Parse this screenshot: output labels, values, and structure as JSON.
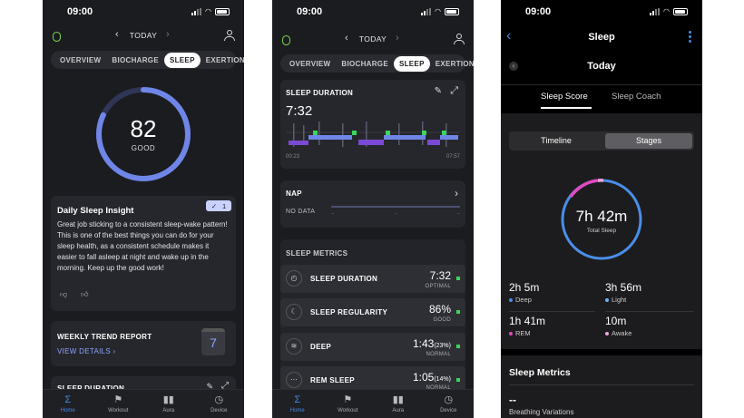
{
  "status": {
    "time": "09:00"
  },
  "nav": {
    "date": "TODAY"
  },
  "tabs": [
    "OVERVIEW",
    "BIOCHARGE",
    "SLEEP",
    "EXERTION"
  ],
  "bottom_tabs": [
    {
      "label": "Home",
      "icon": "sigma-icon"
    },
    {
      "label": "Workout",
      "icon": "runner-icon"
    },
    {
      "label": "Aura",
      "icon": "bars-icon"
    },
    {
      "label": "Device",
      "icon": "watch-icon"
    }
  ],
  "phone1": {
    "score": "82",
    "score_label": "GOOD",
    "score_fraction": 0.82,
    "insight": {
      "title": "Daily Sleep Insight",
      "badge": "1",
      "body": "Great job sticking to a consistent sleep-wake pattern! This is one of the best things you can do for your sleep health, as a consistent schedule makes it easier to fall asleep at night and wake up in the morning. Keep up the good work!"
    },
    "weekly": {
      "title": "WEEKLY TREND REPORT",
      "link": "VIEW DETAILS",
      "calendar_day": "7"
    },
    "next_section": "SLEEP DURATION"
  },
  "phone2": {
    "duration_card": {
      "title": "SLEEP DURATION",
      "value": "7:32",
      "start": "00:23",
      "end": "07:57"
    },
    "nap_card": {
      "title": "NAP",
      "value": "NO DATA",
      "ticks": [
        "--",
        "--",
        "--"
      ]
    },
    "metrics_title": "SLEEP METRICS",
    "metrics": [
      {
        "label": "SLEEP DURATION",
        "value": "7:32",
        "extra": "",
        "status": "OPTIMAL",
        "icon": "clock-icon"
      },
      {
        "label": "SLEEP REGULARITY",
        "value": "86%",
        "extra": "",
        "status": "GOOD",
        "icon": "moon-icon"
      },
      {
        "label": "DEEP",
        "value": "1:43",
        "extra": "(23%)",
        "status": "NORMAL",
        "icon": "deep-sleep-icon"
      },
      {
        "label": "REM SLEEP",
        "value": "1:05",
        "extra": "(14%)",
        "status": "NORMAL",
        "icon": "rem-icon"
      }
    ]
  },
  "phone3": {
    "title": "Sleep",
    "day": "Today",
    "segments": [
      "Sleep Score",
      "Sleep Coach"
    ],
    "toggles": [
      "Timeline",
      "Stages"
    ],
    "total": "7h 42m",
    "total_label": "Total Sleep",
    "stages": [
      {
        "value": "2h 5m",
        "label": "Deep",
        "color": "#4a8ee8"
      },
      {
        "value": "3h 56m",
        "label": "Light",
        "color": "#6fb0f5"
      },
      {
        "value": "1h 41m",
        "label": "REM",
        "color": "#e14ac1"
      },
      {
        "value": "10m",
        "label": "Awake",
        "color": "#f4a6dd"
      }
    ],
    "metrics_title": "Sleep Metrics",
    "metrics_value": "--",
    "metrics_sub": "Breathing Variations"
  },
  "colors": {
    "accent_blue": "#3f8ae6",
    "ring_blue": "#6f86e8",
    "green": "#3ad65a",
    "purple": "#7a4ad6",
    "magenta": "#e14ac1"
  }
}
